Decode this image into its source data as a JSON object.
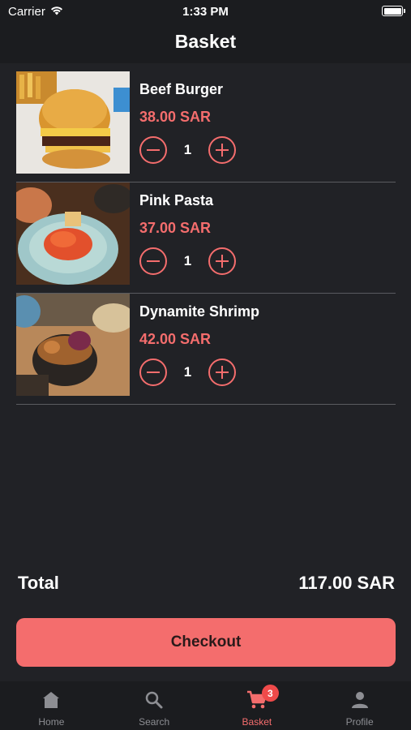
{
  "status_bar": {
    "carrier": "Carrier",
    "time": "1:33 PM"
  },
  "header": {
    "title": "Basket"
  },
  "basket": {
    "items": [
      {
        "name": "Beef Burger",
        "price": "38.00 SAR",
        "quantity": "1"
      },
      {
        "name": "Pink Pasta",
        "price": "37.00 SAR",
        "quantity": "1"
      },
      {
        "name": "Dynamite Shrimp",
        "price": "42.00 SAR",
        "quantity": "1"
      }
    ],
    "total_label": "Total",
    "total_value": "117.00 SAR",
    "checkout_label": "Checkout"
  },
  "tab_bar": {
    "tabs": [
      {
        "label": "Home",
        "icon": "home-icon"
      },
      {
        "label": "Search",
        "icon": "search-icon"
      },
      {
        "label": "Basket",
        "icon": "cart-icon",
        "badge": "3"
      },
      {
        "label": "Profile",
        "icon": "person-icon"
      }
    ]
  },
  "colors": {
    "accent": "#f46d6d",
    "background": "#212226",
    "bar": "#1b1c1f",
    "badge": "#ef4a4a"
  }
}
